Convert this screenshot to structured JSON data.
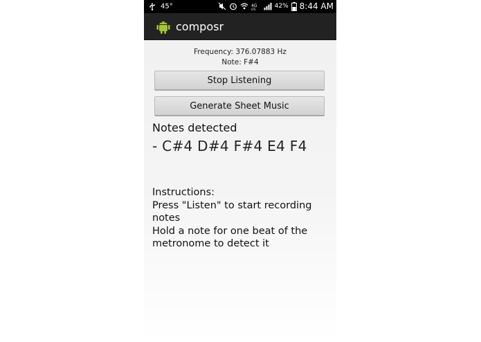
{
  "status_bar": {
    "temperature": "45°",
    "battery_percent": "42%",
    "time": "8:44 AM",
    "icons": [
      "usb-icon",
      "mute-icon",
      "alarm-icon",
      "wifi-icon",
      "4g-lte-icon",
      "signal-icon",
      "battery-icon"
    ]
  },
  "action_bar": {
    "title": "composr",
    "icon": "android-icon",
    "icon_color": "#a4c639"
  },
  "readout": {
    "frequency": "Frequency: 376.07883 Hz",
    "note": "Note: F#4"
  },
  "buttons": {
    "stop_listening": "Stop Listening",
    "generate_sheet_music": "Generate Sheet Music"
  },
  "notes": {
    "heading": "Notes detected",
    "list": "- C#4 D#4 F#4 E4 F4"
  },
  "instructions": {
    "title": "Instructions:",
    "line1": "Press \"Listen\" to start recording notes",
    "line2": "Hold a note for one beat of the metronome to detect it"
  }
}
